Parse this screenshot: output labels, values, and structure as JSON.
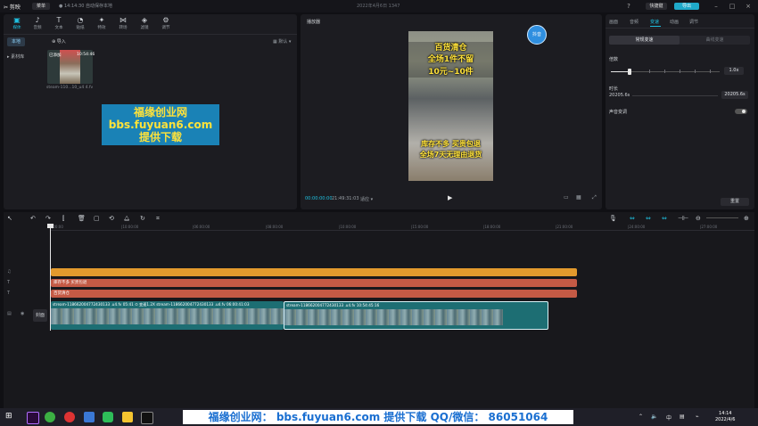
{
  "titlebar": {
    "logo": "✂ 剪映",
    "menu": "菜单",
    "autosave": "● 14:14:30 自动保存本地",
    "project_title": "2022年4月6日 1347",
    "shortcut": "快捷键",
    "export": "导出"
  },
  "media": {
    "tools": [
      {
        "label": "媒体",
        "icon": "▣"
      },
      {
        "label": "音频",
        "icon": "♪"
      },
      {
        "label": "文本",
        "icon": "T"
      },
      {
        "label": "贴纸",
        "icon": "◔"
      },
      {
        "label": "特效",
        "icon": "✦"
      },
      {
        "label": "转场",
        "icon": "⋈"
      },
      {
        "label": "滤镜",
        "icon": "◈"
      },
      {
        "label": "调节",
        "icon": "⚙"
      }
    ],
    "side_local": "本地",
    "side_library": "▸ 素材库",
    "import": "⊕ 导入",
    "sort": "▦ 默认 ▾",
    "thumb_added": "已添加",
    "thumb_duration": "10:54:46",
    "thumb_name": "steam-110...10_u4 4.fv"
  },
  "watermark": {
    "line1": "福缘创业网",
    "line2": "bbs.fuyuan6.com",
    "line3": "提供下载"
  },
  "player": {
    "title": "播放器",
    "video_line1": "百货清仓",
    "video_line2": "全场1件不留",
    "video_line3": "10元~10件",
    "video_line4": "库存不多 买贵包退",
    "video_line5": "全场7天无理由退货",
    "avatar": "抖音",
    "timecode": "00:00:00:00",
    "duration": "21:49:31:03",
    "ratio": "适应 ▾"
  },
  "props": {
    "tabs": [
      "画面",
      "音频",
      "变速",
      "动画",
      "调节"
    ],
    "seg_a": "常规变速",
    "seg_b": "曲线变速",
    "speed_label": "倍数",
    "speed_value": "1.0x",
    "dur_label": "时长",
    "dur_old": "20205.6s",
    "dur_new": "20205.6s",
    "pitch_label": "声音变调",
    "reset": "重置"
  },
  "timeline": {
    "ruler": [
      "|00:00",
      "|10:00:00",
      "|06:00:00",
      "|08:00:00",
      "|10:00:00",
      "|15:00:00",
      "|18:00:00",
      "|21:00:00",
      "|24:00:00",
      "|27:00:00"
    ],
    "t1_text": "库存不多 买贵包退",
    "t2_text": "百货清仓",
    "cover": "封面",
    "clip1_title": "stream-1186620047724301​33 .u4.fv  05:41  ⊙ 变速1.2X  stream-1186620047724301​33 .u4.fv  06:00:41:03",
    "clip2_title": "stream-1186620047724301​33 .u4.fv  10:54:45:16"
  },
  "taskbar": {
    "banner": "福缘创业网： bbs.fuyuan6.com  提供下载    QQ/微信：  86051064",
    "time": "14:14",
    "date": "2022/4/6",
    "ime": "中"
  },
  "colors": {
    "accent": "#1fc0e0",
    "export": "#1fa9c9",
    "audio_track": "#e39a2d",
    "text_track": "#c45a45",
    "video_clip": "#1d6e73"
  }
}
